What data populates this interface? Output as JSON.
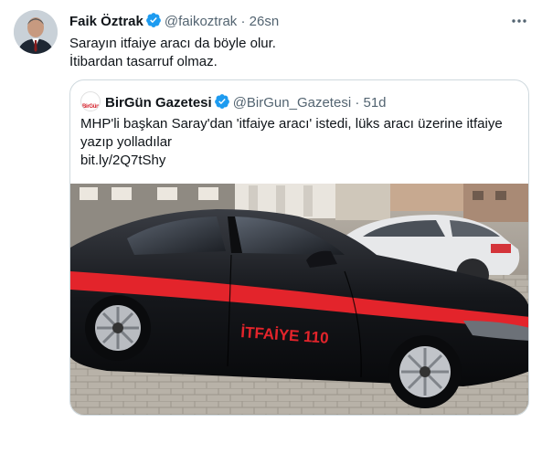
{
  "tweet": {
    "author_name": "Faik Öztrak",
    "author_handle": "@faikoztrak",
    "separator": "·",
    "time": "26sn",
    "text_lines": [
      "Sarayın itfaiye aracı da böyle olur.",
      "İtibardan tasarruf olmaz."
    ]
  },
  "quote": {
    "avatar_text": "BirGün",
    "author_name": "BirGün Gazetesi",
    "author_handle": "@BirGun_Gazetesi",
    "separator": "·",
    "time": "51d",
    "text_lines": [
      "MHP'li başkan Saray'dan 'itfaiye aracı' istedi, lüks aracı üzerine itfaiye",
      "yazıp yolladılar",
      "bit.ly/2Q7tShy"
    ],
    "image_car_text": "İTFAİYE 110"
  },
  "colors": {
    "verified": "#1d9bf0",
    "secondary_text": "#536471",
    "stripe": "#e3242b"
  }
}
